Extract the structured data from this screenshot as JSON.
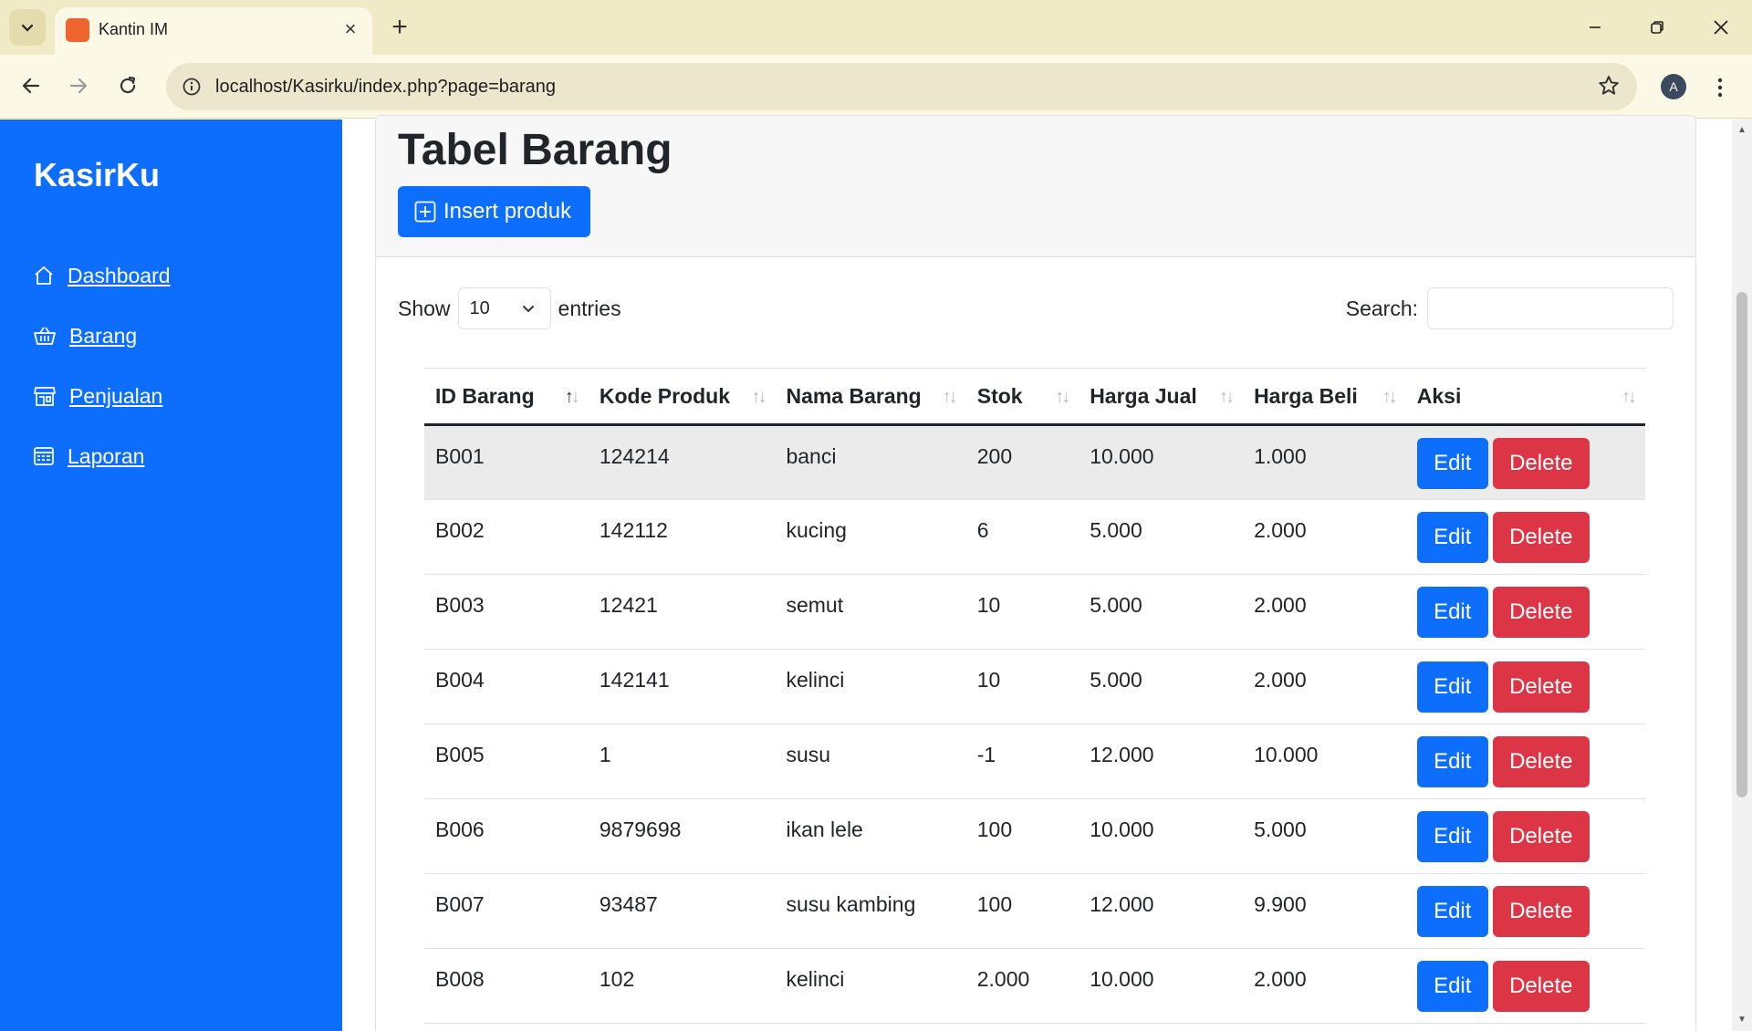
{
  "browser": {
    "tab_title": "Kantin IM",
    "url": "localhost/Kasirku/index.php?page=barang",
    "avatar_letter": "A"
  },
  "sidebar": {
    "brand": "KasirKu",
    "items": [
      {
        "label": "Dashboard",
        "icon": "home-icon"
      },
      {
        "label": "Barang",
        "icon": "basket-icon"
      },
      {
        "label": "Penjualan",
        "icon": "shop-icon"
      },
      {
        "label": "Laporan",
        "icon": "calculator-icon"
      }
    ]
  },
  "main": {
    "title": "Tabel Barang",
    "insert_label": "Insert produk",
    "show_label": "Show",
    "entries_value": "10",
    "entries_label": "entries",
    "search_label": "Search:"
  },
  "table": {
    "headers": [
      "ID Barang",
      "Kode Produk",
      "Nama Barang",
      "Stok",
      "Harga Jual",
      "Harga Beli",
      "Aksi"
    ],
    "edit_label": "Edit",
    "delete_label": "Delete",
    "rows": [
      [
        "B001",
        "124214",
        "banci",
        "200",
        "10.000",
        "1.000"
      ],
      [
        "B002",
        "142112",
        "kucing",
        "6",
        "5.000",
        "2.000"
      ],
      [
        "B003",
        "12421",
        "semut",
        "10",
        "5.000",
        "2.000"
      ],
      [
        "B004",
        "142141",
        "kelinci",
        "10",
        "5.000",
        "2.000"
      ],
      [
        "B005",
        "1",
        "susu",
        "-1",
        "12.000",
        "10.000"
      ],
      [
        "B006",
        "9879698",
        "ikan lele",
        "100",
        "10.000",
        "5.000"
      ],
      [
        "B007",
        "93487",
        "susu kambing",
        "100",
        "12.000",
        "9.900"
      ],
      [
        "B008",
        "102",
        "kelinci",
        "2.000",
        "10.000",
        "2.000"
      ]
    ]
  }
}
